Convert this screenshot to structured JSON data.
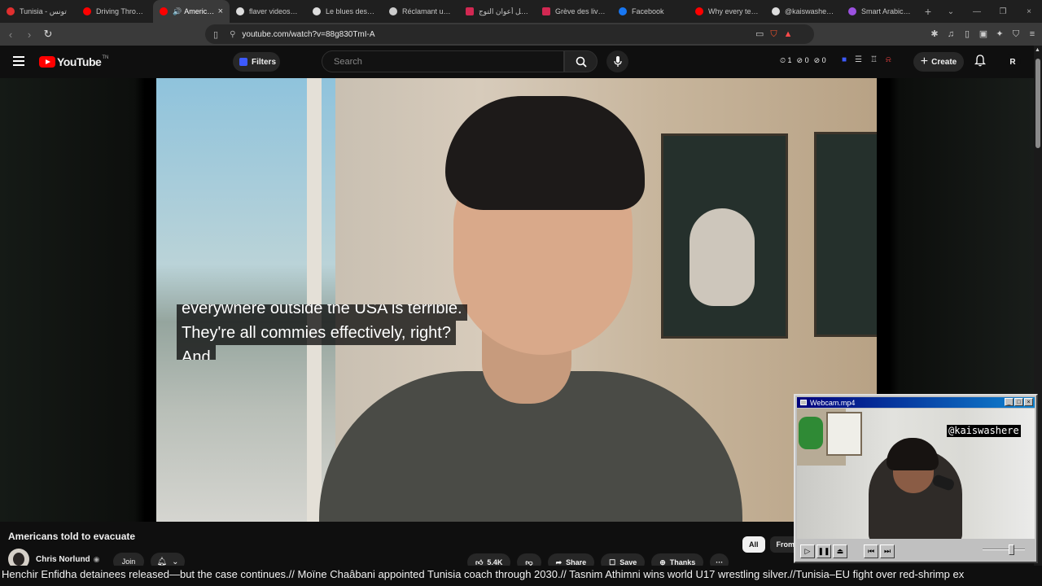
{
  "browser": {
    "tabs": [
      {
        "title": "Tunisia - تونس",
        "color": "#e02f2f"
      },
      {
        "title": "Driving Through",
        "color": "#ff0000"
      },
      {
        "title": "American",
        "color": "#ff0000",
        "active": true
      },
      {
        "title": "flaver videos - D",
        "color": "#dddddd"
      },
      {
        "title": "Le blues des livr",
        "color": "#dddddd"
      },
      {
        "title": "Réclamant un re",
        "color": "#cccccc"
      },
      {
        "title": "عاجل أعوان التوج",
        "color": "#d22852"
      },
      {
        "title": "Grève des livreu",
        "color": "#d22852"
      },
      {
        "title": "Facebook",
        "color": "#1877f2"
      },
      {
        "title": "Why every tech",
        "color": "#ff0000"
      },
      {
        "title": "@kaiswashere -",
        "color": "#dddddd"
      },
      {
        "title": "Smart Arabic Key",
        "color": "#9b51e0"
      }
    ],
    "new_tab": "+",
    "url": "youtube.com/watch?v=88g830TmI-A"
  },
  "youtube": {
    "logo": "YouTube",
    "logo_sup": "TN",
    "filters_label": "Filters",
    "search_placeholder": "Search",
    "stats": {
      "a": "1",
      "b": "0",
      "c": "0"
    },
    "create_label": "Create",
    "avatar_letter": "R"
  },
  "video": {
    "captions": [
      "everywhere outside the USA is terrible.",
      "They're all commies effectively, right?",
      "And"
    ],
    "title": "Americans told to evacuate",
    "channel": "Chris Norlund",
    "join_label": "Join",
    "likes": "5.4K",
    "share_label": "Share",
    "save_label": "Save",
    "thanks_label": "Thanks",
    "more_label": "···"
  },
  "chips": [
    "All",
    "From"
  ],
  "ticker_text": "Henchir Enfidha detainees released—but the case continues.// Moïne Chaâbani appointed Tunisia coach through 2030.// Tasnim Athimni wins world U17 wrestling silver.//Tunisia–EU fight over red-shrimp ex",
  "media_player": {
    "title": "Webcam.mp4",
    "handle": "@kaiswashere"
  },
  "icons": {
    "close": "×",
    "mic": "🎤",
    "bell": "🔔",
    "like": "👍",
    "dislike": "👎",
    "share": "➦"
  }
}
